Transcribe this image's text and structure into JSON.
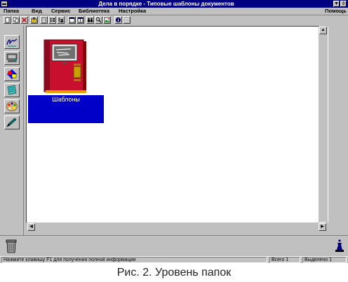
{
  "window": {
    "title": "Дела в порядке - Типовые шаблоны документов"
  },
  "menu": {
    "items": [
      {
        "label": "Папка"
      },
      {
        "label": "Вид"
      },
      {
        "label": "Сервис"
      },
      {
        "label": "Библиотека"
      },
      {
        "label": "Настройка"
      }
    ],
    "help": "Помощь"
  },
  "toolbar": {
    "icons": [
      "new-doc-icon",
      "copy-doc-icon",
      "delete-icon",
      "folder-up-icon",
      "page-icon",
      "tree-icon",
      "tree-alt-icon",
      "window-icon",
      "window-split-icon",
      "binoculars-icon",
      "search-icon",
      "image-icon",
      "info-icon",
      "grid-icon"
    ]
  },
  "left_tools": [
    "signature-icon",
    "desk-icon",
    "shapes-icon",
    "notebook-icon",
    "palette-icon",
    "pen-icon"
  ],
  "content": {
    "folders": [
      {
        "label": "Шаблоны",
        "icon": "binder-icon"
      }
    ]
  },
  "status": {
    "hint": "Нажмите клавишу F1 для получения полной информации",
    "total": "Всего 1",
    "selected": "Выделено 1"
  },
  "caption": "Рис. 2. Уровень папок",
  "colors": {
    "titlebar": "#000080",
    "selection": "#0000c8",
    "binder": "#c8102e"
  }
}
